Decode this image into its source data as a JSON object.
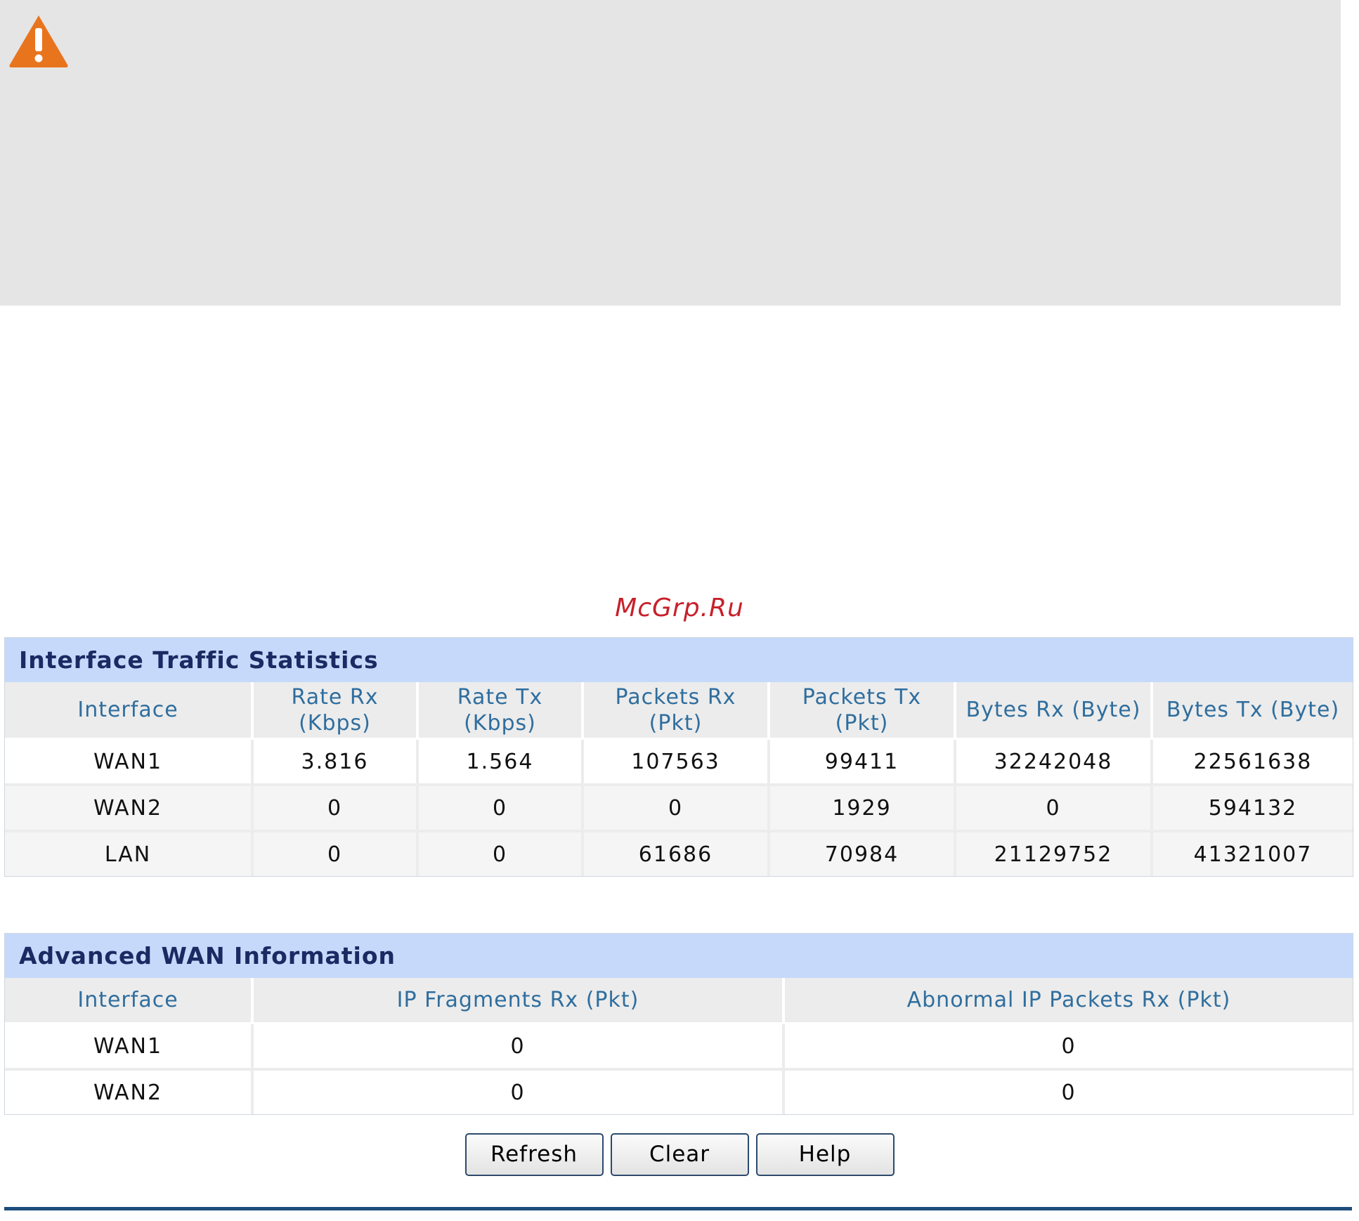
{
  "watermark": "McGrp.Ru",
  "colors": {
    "warning_icon": "#e8741e",
    "panel_header_bg": "#c6d9fb",
    "column_header_text": "#2f6e9e",
    "watermark": "#c8202a"
  },
  "traffic": {
    "title": "Interface Traffic Statistics",
    "headers": [
      [
        "Interface"
      ],
      [
        "Rate Rx",
        "(Kbps)"
      ],
      [
        "Rate Tx",
        "(Kbps)"
      ],
      [
        "Packets Rx",
        "(Pkt)"
      ],
      [
        "Packets Tx",
        "(Pkt)"
      ],
      [
        "Bytes Rx (Byte)"
      ],
      [
        "Bytes Tx (Byte)"
      ]
    ],
    "rows": [
      [
        "WAN1",
        "3.816",
        "1.564",
        "107563",
        "99411",
        "32242048",
        "22561638"
      ],
      [
        "WAN2",
        "0",
        "0",
        "0",
        "1929",
        "0",
        "594132"
      ],
      [
        "LAN",
        "0",
        "0",
        "61686",
        "70984",
        "21129752",
        "41321007"
      ]
    ]
  },
  "advanced": {
    "title": "Advanced WAN Information",
    "headers": [
      "Interface",
      "IP Fragments Rx (Pkt)",
      "Abnormal IP Packets Rx (Pkt)"
    ],
    "rows": [
      [
        "WAN1",
        "0",
        "0"
      ],
      [
        "WAN2",
        "0",
        "0"
      ]
    ]
  },
  "buttons": {
    "refresh": "Refresh",
    "clear": "Clear",
    "help": "Help"
  }
}
